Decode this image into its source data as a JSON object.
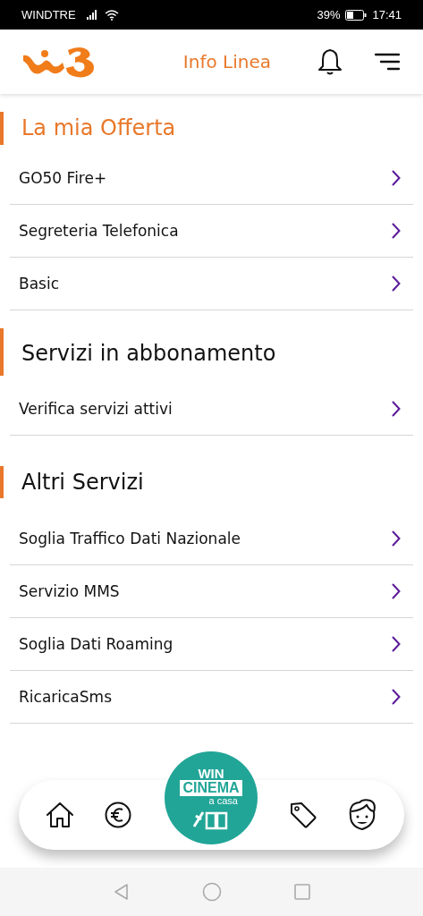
{
  "status_bar": {
    "carrier": "WINDTRE",
    "battery": "39%",
    "time": "17:41"
  },
  "header": {
    "title": "Info Linea"
  },
  "sections": [
    {
      "title": "La mia Offerta",
      "highlighted": true,
      "items": [
        "GO50 Fire+",
        "Segreteria Telefonica",
        "Basic"
      ]
    },
    {
      "title": "Servizi in abbonamento",
      "highlighted": false,
      "items": [
        "Verifica servizi attivi"
      ]
    },
    {
      "title": "Altri Servizi",
      "highlighted": false,
      "items": [
        "Soglia Traffico Dati Nazionale",
        "Servizio MMS",
        "Soglia Dati Roaming",
        "RicaricaSms"
      ]
    }
  ],
  "promo": {
    "line_1": "WIN",
    "line_2": "CINEMA",
    "line_3": "a casa"
  }
}
